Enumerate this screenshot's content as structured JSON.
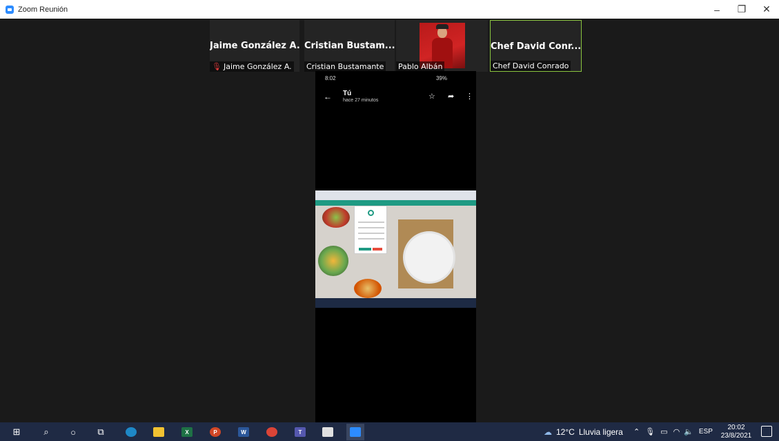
{
  "window": {
    "title": "Zoom Reunión",
    "controls": {
      "minimize": "–",
      "restore": "❐",
      "close": "✕"
    }
  },
  "participants": [
    {
      "display_name": "Jaime González A.",
      "label": "Jaime González A.",
      "muted": true
    },
    {
      "display_name": "Cristian  Bustam...",
      "label": "Cristian Bustamante",
      "muted": false
    },
    {
      "display_name": "",
      "label": "Pablo Albán",
      "muted": false,
      "has_video": true
    },
    {
      "display_name": "Chef  David  Conr...",
      "label": "Chef David Conrado",
      "muted": false,
      "active_speaker": true
    }
  ],
  "shared_screen": {
    "phone_status": {
      "time": "8:02",
      "battery": "39%"
    },
    "message_header": {
      "sender": "Tú",
      "time_ago": "hace 27 minutos"
    },
    "expand_toggle": "›"
  },
  "taskbar": {
    "weather": {
      "temperature": "12°C",
      "condition": "Lluvia ligera"
    },
    "language": "ESP",
    "time": "20:02",
    "date": "23/8/2021"
  },
  "colors": {
    "zoom_blue": "#2d8cff",
    "active_speaker_border": "#8ac43f",
    "muted_mic": "#e03b3b",
    "taskbar_bg": "#1f2a44",
    "meeting_bg": "#1a1a1a"
  }
}
